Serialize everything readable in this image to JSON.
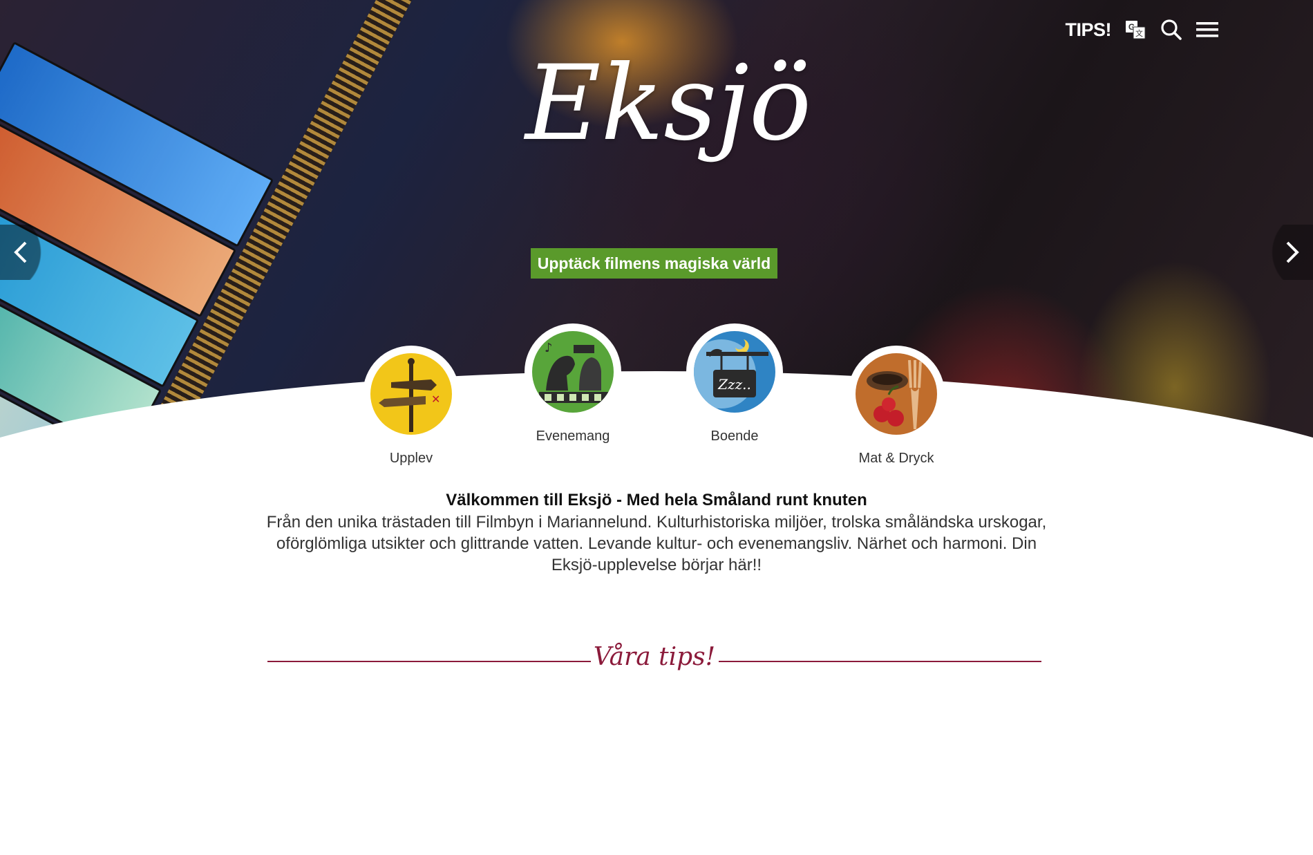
{
  "nav": {
    "tips_label": "TIPS!",
    "icons": [
      "translate-icon",
      "search-icon",
      "menu-icon"
    ]
  },
  "hero": {
    "logo_text": "Eksjö",
    "cta_label": "Upptäck filmens magiska värld"
  },
  "categories": [
    {
      "label": "Upplev",
      "icon": "signpost-icon",
      "color": "#f2c619"
    },
    {
      "label": "Evenemang",
      "icon": "cinema-horse-icon",
      "color": "#58a53a"
    },
    {
      "label": "Boende",
      "icon": "sleep-sign-icon",
      "color": "#2f84c4"
    },
    {
      "label": "Mat & Dryck",
      "icon": "coffee-cherries-icon",
      "color": "#c06d2c"
    }
  ],
  "intro": {
    "title": "Välkommen till Eksjö - Med hela Småland runt knuten",
    "text": "Från den unika trästaden till Filmbyn i Mariannelund. Kulturhistoriska miljöer, trolska småländska urskogar, oförglömliga utsikter och glittrande vatten. Levande kultur- och evenemangsliv. Närhet och harmoni. Din Eksjö-upplevelse börjar här!!"
  },
  "section": {
    "tips_title": "Våra tips!"
  },
  "colors": {
    "accent_green": "#5a9a2b",
    "accent_burgundy": "#8b1a3a"
  }
}
